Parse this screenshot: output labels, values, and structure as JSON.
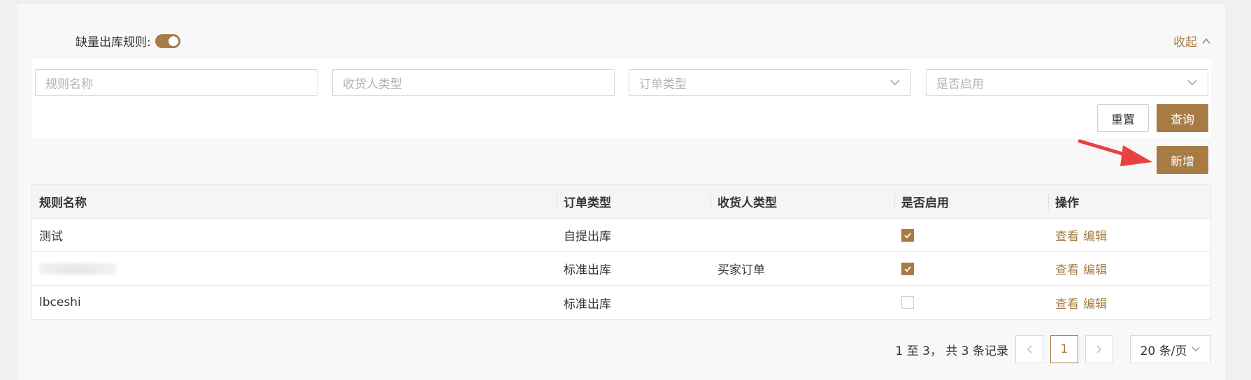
{
  "toggle_label": "缺量出库规则:",
  "collapse_label": "收起",
  "filters": {
    "rule_name_placeholder": "规则名称",
    "consignee_type_placeholder": "收货人类型",
    "order_type_placeholder": "订单类型",
    "enabled_placeholder": "是否启用"
  },
  "buttons": {
    "reset": "重置",
    "query": "查询",
    "add": "新增"
  },
  "table": {
    "headers": [
      "规则名称",
      "订单类型",
      "收货人类型",
      "是否启用",
      "操作"
    ],
    "rows": [
      {
        "name": "测试",
        "order_type": "自提出库",
        "consignee_type": "",
        "enabled": true,
        "view": "查看",
        "edit": "编辑"
      },
      {
        "name": "",
        "order_type": "标准出库",
        "consignee_type": "买家订单",
        "enabled": true,
        "view": "查看",
        "edit": "编辑"
      },
      {
        "name": "lbceshi",
        "order_type": "标准出库",
        "consignee_type": "",
        "enabled": false,
        "view": "查看",
        "edit": "编辑"
      }
    ]
  },
  "pagination": {
    "summary": "1 至 3， 共 3 条记录",
    "current_page": "1",
    "page_size": "20 条/页"
  },
  "colors": {
    "accent": "#a77b45",
    "arrow": "#e8413f"
  }
}
